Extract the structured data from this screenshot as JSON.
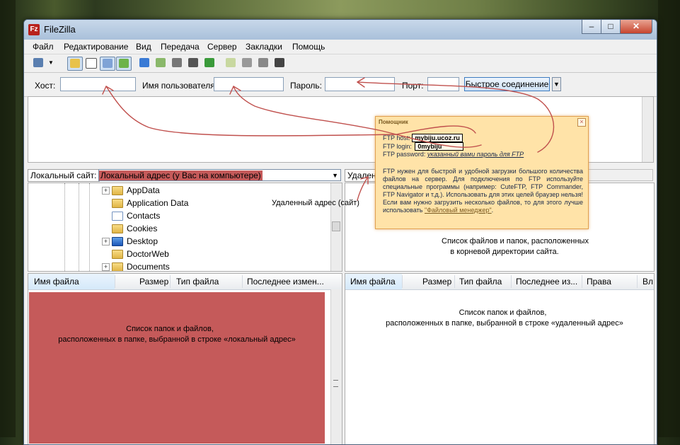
{
  "window": {
    "title": "FileZilla"
  },
  "menu": [
    "Файл",
    "Редактирование",
    "Вид",
    "Передача",
    "Сервер",
    "Закладки",
    "Помощь"
  ],
  "quickconnect": {
    "host_label": "Хост:",
    "user_label": "Имя пользователя",
    "pass_label": "Пароль:",
    "port_label": "Порт:",
    "button_label": "Быстрое соединение",
    "host_value": "",
    "user_value": "",
    "pass_value": "",
    "port_value": ""
  },
  "local": {
    "site_label": "Локальный сайт:",
    "path_value": "Локальный  адрес (у Вас на компьютере)",
    "tree": [
      "AppData",
      "Application Data",
      "Contacts",
      "Cookies",
      "Desktop",
      "DoctorWeb",
      "Documents"
    ],
    "columns": [
      "Имя файла",
      "Размер",
      "Тип файла",
      "Последнее измен..."
    ]
  },
  "remote": {
    "site_label_partial": "Удален",
    "columns": [
      "Имя файла",
      "Размер",
      "Тип файла",
      "Последнее из...",
      "Права",
      "Вл"
    ]
  },
  "annotations": {
    "remote_address": "Удаленный адрес (сайт)",
    "remote_tree": [
      "Список файлов и папок, расположенных",
      "в корневой директории сайта."
    ],
    "local_list": [
      "Список папок и файлов,",
      "расположенных в папке, выбранной в строке «локальный адрес»"
    ],
    "remote_list": [
      "Список папок и файлов,",
      "расположенных в папке, выбранной в строке «удаленный адрес»"
    ]
  },
  "helper": {
    "title": "Помощник",
    "host_label": "FTP host:",
    "host_value": "mybiju.ucoz.ru",
    "login_label": "FTP login:",
    "login_value": "0mybiju",
    "password_label": "FTP password:",
    "password_value": "указанный вами пароль для FTP",
    "text": "FTP нужен для быстрой и удобной загрузки большого количества файлов на сервер. Для подключения по FTP используйте специальные программы (например: CuteFTP, FTP Commander, FTP Navigator и т.д.). Использовать для этих целей браузер нельзя! Если вам нужно загрузить несколько файлов, то для этого лучше использовать",
    "link": "\"Файловый менеджер\"",
    "tail": "."
  },
  "colors": {
    "highlight_red": "#c55a5a",
    "helper_bg": "#ffe3a8",
    "arrow": "#c0504d"
  }
}
